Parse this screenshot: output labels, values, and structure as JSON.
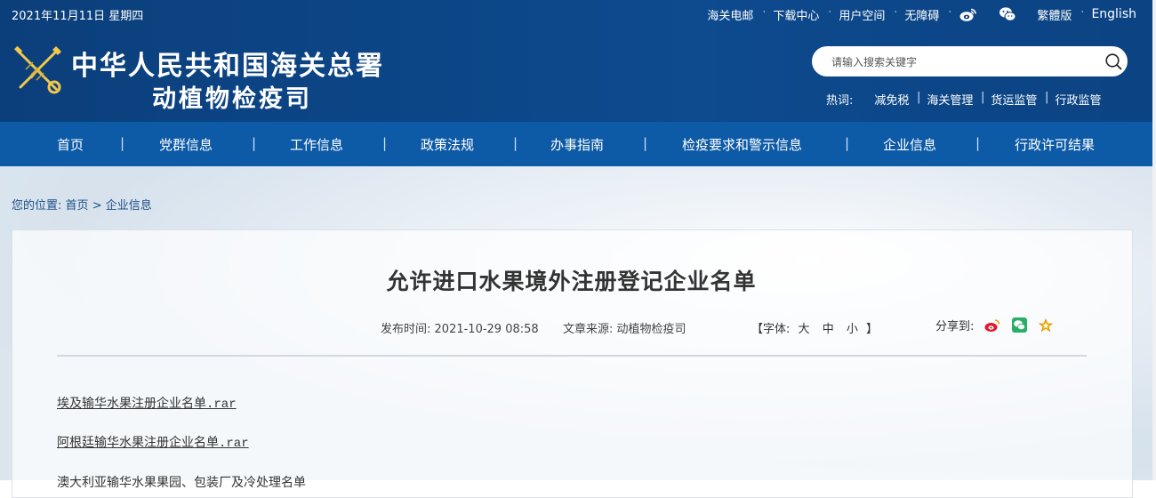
{
  "topbar": {
    "date": "2021年11月11日 星期四",
    "links": [
      {
        "label": "海关电邮"
      },
      {
        "label": "下载中心"
      },
      {
        "label": "用户空间"
      },
      {
        "label": "无障碍"
      }
    ],
    "icons": [
      "weibo-icon",
      "wechat-icon"
    ],
    "traditional": "繁體版",
    "english": "English"
  },
  "header": {
    "title_line1": "中华人民共和国海关总署",
    "title_line2": "动植物检疫司"
  },
  "search": {
    "placeholder": "请输入搜索关键字"
  },
  "hot": {
    "label": "热词:",
    "items": [
      "减免税",
      "海关管理",
      "货运监管",
      "行政监管"
    ]
  },
  "nav": {
    "items": [
      "首页",
      "党群信息",
      "工作信息",
      "政策法规",
      "办事指南",
      "检疫要求和警示信息",
      "企业信息",
      "行政许可结果"
    ],
    "separator": "|"
  },
  "breadcrumb": {
    "prefix": "您的位置:",
    "home": "首页",
    "sep": ">",
    "current": "企业信息"
  },
  "article": {
    "title": "允许进口水果境外注册登记企业名单",
    "publish_label": "发布时间:",
    "publish_time": "2021-10-29 08:58",
    "source_label": "文章来源:",
    "source": "动植物检疫司",
    "font_prefix": "【字体:",
    "font_large": "大",
    "font_medium": "中",
    "font_small": "小",
    "font_suffix": "】",
    "share_label": "分享到:",
    "files": [
      {
        "name": "埃及输华水果注册企业名单",
        "ext": ".rar"
      },
      {
        "name": "阿根廷输华水果注册企业名单",
        "ext": ".rar"
      }
    ],
    "partial_line": "澳大利亚输华水果果园、包装厂及冷处理名单"
  },
  "colors": {
    "header_bg": "#0c4382",
    "nav_bg": "#0d5aa7",
    "title_text": "#333333",
    "breadcrumb_text": "#1d4f86"
  }
}
